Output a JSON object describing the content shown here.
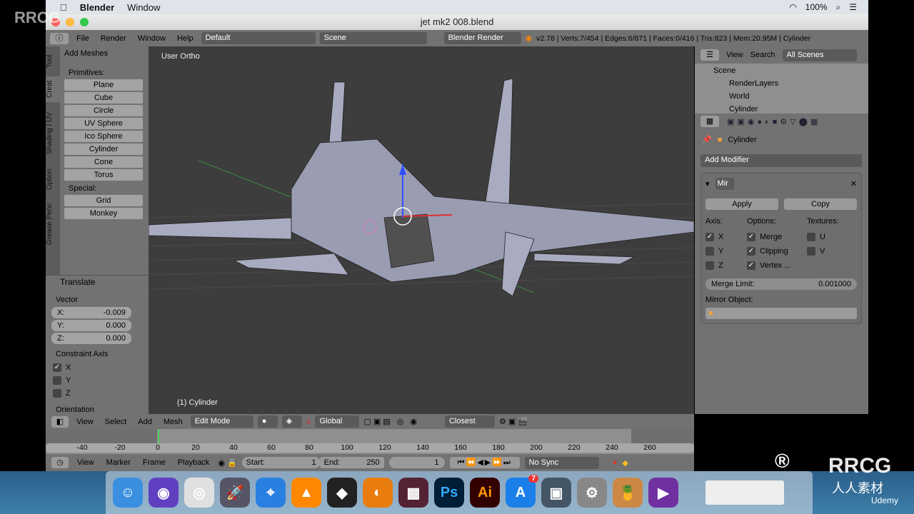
{
  "mac_menu": {
    "app": "Blender",
    "items": [
      "Window"
    ],
    "battery": "100%"
  },
  "window": {
    "title": "jet mk2 008.blend"
  },
  "header": {
    "menus": [
      "File",
      "Render",
      "Window",
      "Help"
    ],
    "layout": "Default",
    "scene": "Scene",
    "engine": "Blender Render",
    "stats": "v2.78 | Verts:7/454 | Edges:6/871 | Faces:0/416 | Tris:823 | Mem:20.95M | Cylinder"
  },
  "toolshelf": {
    "tabs": [
      "Tool",
      "Creat",
      "Shading / UV",
      "Option",
      "Grease Penc"
    ],
    "panel_title": "Add Meshes",
    "primitives_label": "Primitives:",
    "primitives": [
      "Plane",
      "Cube",
      "Circle",
      "UV Sphere",
      "Ico Sphere",
      "Cylinder",
      "Cone",
      "Torus"
    ],
    "special_label": "Special:",
    "special": [
      "Grid",
      "Monkey"
    ]
  },
  "operator": {
    "title": "Translate",
    "vector_label": "Vector",
    "x_label": "X:",
    "x": "-0.009",
    "y_label": "Y:",
    "y": "0.000",
    "z_label": "Z:",
    "z": "0.000",
    "constraint_label": "Constraint Axis",
    "axes": [
      {
        "label": "X",
        "checked": true
      },
      {
        "label": "Y",
        "checked": false
      },
      {
        "label": "Z",
        "checked": false
      }
    ],
    "orientation_label": "Orientation"
  },
  "viewport": {
    "view_label": "User Ortho",
    "object_label": "(1) Cylinder"
  },
  "outliner": {
    "menus": [
      "View",
      "Search"
    ],
    "filter": "All Scenes",
    "items": [
      "Scene",
      "RenderLayers",
      "World",
      "Cylinder"
    ]
  },
  "properties": {
    "object": "Cylinder",
    "add_modifier": "Add Modifier",
    "modifier_name": "Mir",
    "apply": "Apply",
    "copy": "Copy",
    "axis_label": "Axis:",
    "options_label": "Options:",
    "textures_label": "Textures:",
    "axes": [
      {
        "label": "X",
        "checked": true
      },
      {
        "label": "Y",
        "checked": false
      },
      {
        "label": "Z",
        "checked": false
      }
    ],
    "options": [
      {
        "label": "Merge",
        "checked": true
      },
      {
        "label": "Clipping",
        "checked": true
      },
      {
        "label": "Vertex ...",
        "checked": true
      }
    ],
    "textures": [
      {
        "label": "U",
        "checked": false
      },
      {
        "label": "V",
        "checked": false
      }
    ],
    "merge_limit_label": "Merge Limit:",
    "merge_limit": "0.001000",
    "mirror_object_label": "Mirror Object:"
  },
  "view3d_header": {
    "menus": [
      "View",
      "Select",
      "Add",
      "Mesh"
    ],
    "mode": "Edit Mode",
    "orientation": "Global",
    "snap": "Closest"
  },
  "timeline": {
    "ticks": [
      "-40",
      "-20",
      "0",
      "20",
      "40",
      "60",
      "80",
      "100",
      "120",
      "140",
      "160",
      "180",
      "200",
      "220",
      "240",
      "260"
    ],
    "current_frame": 0,
    "menus": [
      "View",
      "Marker",
      "Frame",
      "Playback"
    ],
    "start_label": "Start:",
    "start": "1",
    "end_label": "End:",
    "end": "250",
    "frame": "1",
    "sync": "No Sync"
  },
  "dock": {
    "apps": [
      "Finder",
      "Siri",
      "Chrome",
      "Launchpad",
      "Safari",
      "VLC",
      "Unity",
      "Blender",
      "Game",
      "Ps",
      "Ai",
      "App Store",
      "Preview",
      "System Preferences",
      "Photo",
      "Screenshot"
    ],
    "app_store_badge": "7"
  },
  "watermark": {
    "brand": "RRCG",
    "sub": "人人素材",
    "udemy": "Udemy"
  }
}
